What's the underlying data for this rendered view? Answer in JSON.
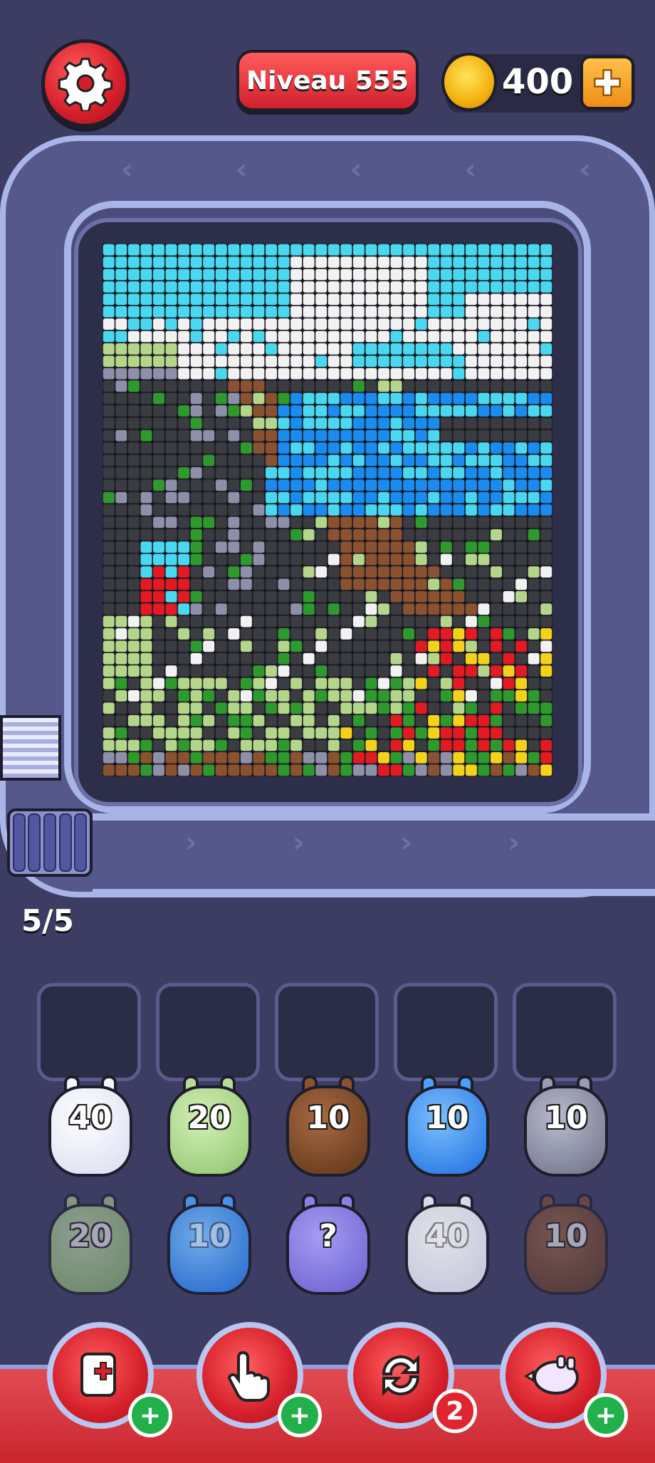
{
  "header": {
    "settings_icon": "gear-icon",
    "level_label": "Niveau 555",
    "coins": "400",
    "add_coins_icon": "plus-icon"
  },
  "track": {
    "queue_counter": "5/5"
  },
  "colors": {
    "sky": "#4ad8f0",
    "cloud": "#f2f2f2",
    "sea": "#1a8cf0",
    "rock": "#3a3c42",
    "stone": "#8e8fa8",
    "dirt": "#8a5230",
    "grass_light": "#b4d68a",
    "grass": "#2e9a2e",
    "flower_red": "#e21a22",
    "flower_yellow": "#f4d21a"
  },
  "pig_rows": [
    [
      {
        "count": "40",
        "color": "white"
      },
      {
        "count": "20",
        "color": "light-green"
      },
      {
        "count": "10",
        "color": "brown"
      },
      {
        "count": "10",
        "color": "blue"
      },
      {
        "count": "10",
        "color": "gray"
      }
    ],
    [
      {
        "count": "20",
        "color": "light-green"
      },
      {
        "count": "10",
        "color": "blue"
      },
      {
        "count": "?",
        "color": "mystery-purple"
      },
      {
        "count": "40",
        "color": "white"
      },
      {
        "count": "10",
        "color": "brown"
      }
    ]
  ],
  "powerups": [
    {
      "icon": "add-slot-icon",
      "badge": "+"
    },
    {
      "icon": "pointer-hand-icon",
      "badge": "+"
    },
    {
      "icon": "shuffle-icon",
      "badge": "2"
    },
    {
      "icon": "pig-rocket-icon",
      "badge": "+"
    }
  ]
}
